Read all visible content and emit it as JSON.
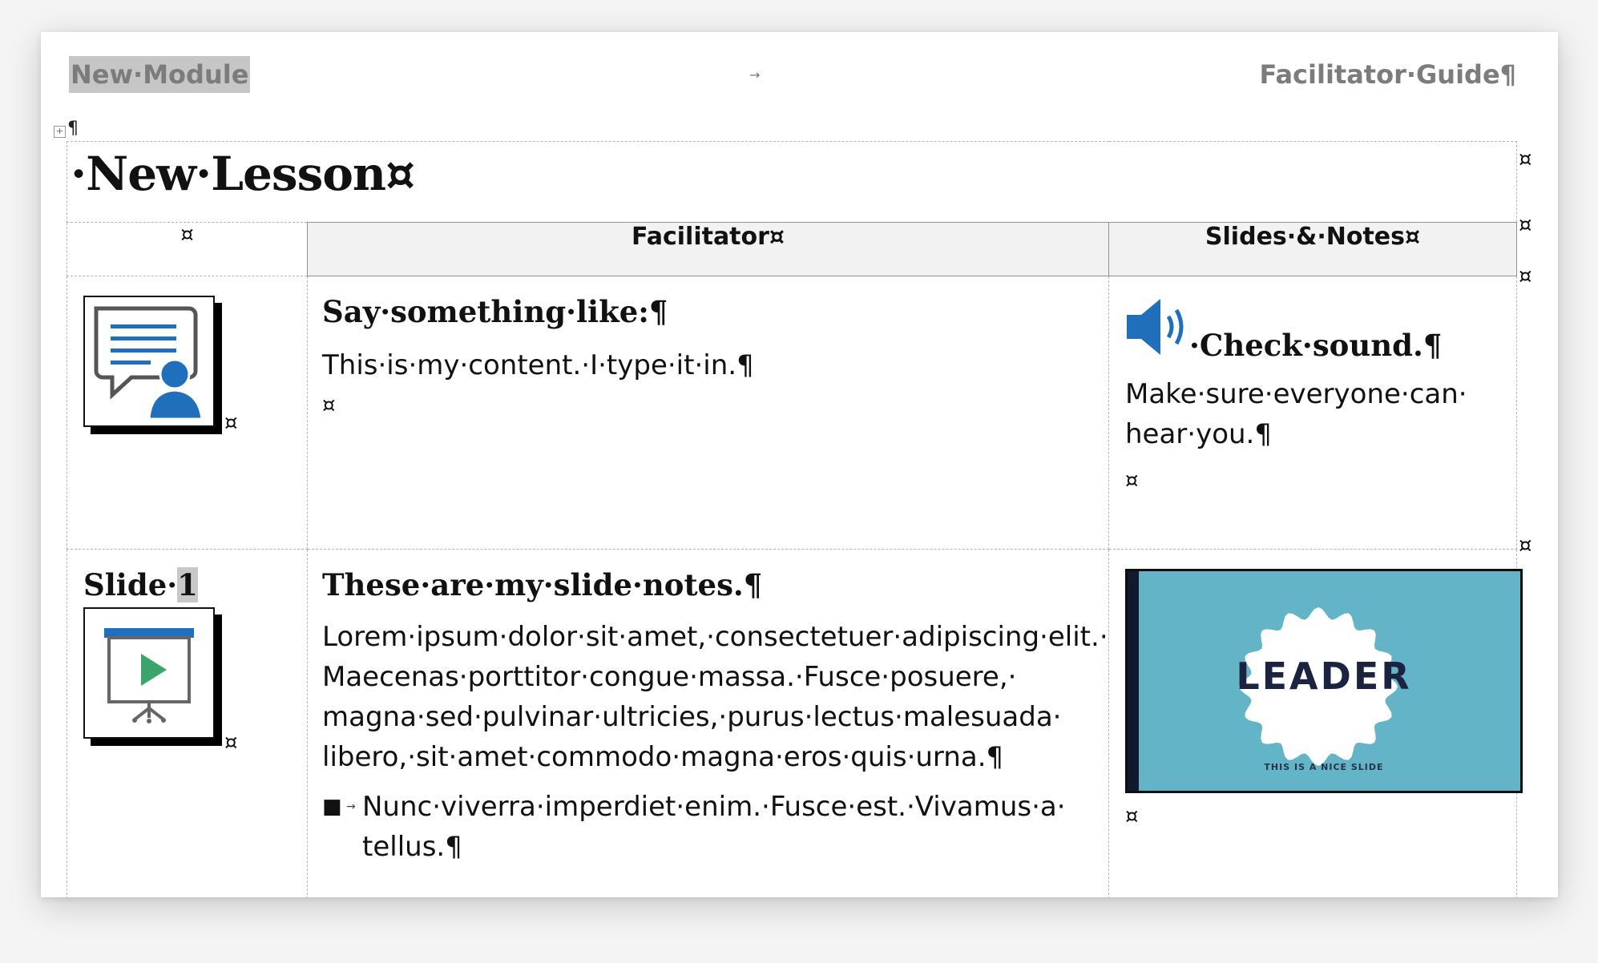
{
  "header": {
    "module": "New·Module",
    "arrow": "→",
    "guide": "Facilitator·Guide¶"
  },
  "marks": {
    "pilcrow": "¶",
    "cell_end": "¤"
  },
  "lesson": {
    "title": "·New·Lesson¤"
  },
  "columns": {
    "blank": "¤",
    "facilitator": "Facilitator¤",
    "slides": "Slides·&·Notes¤"
  },
  "row1": {
    "facilitator_heading": "Say·something·like:¶",
    "facilitator_body": "This·is·my·content.·I·type·it·in.¶",
    "notes_heading": "·Check·sound.¶",
    "notes_body_line1": "Make·sure·everyone·can·",
    "notes_body_line2": "hear·you.¶",
    "icons": {
      "left": "presenter-chat-icon",
      "right": "speaker-volume-icon"
    }
  },
  "row2": {
    "slide_label": "Slide·",
    "slide_number": "1",
    "facilitator_heading": "These·are·my·slide·notes.¶",
    "lorem_lines": [
      "Lorem·ipsum·dolor·sit·amet,·consectetuer·adipiscing·elit.·",
      "Maecenas·porttitor·congue·massa.·Fusce·posuere,·",
      "magna·sed·pulvinar·ultricies,·purus·lectus·malesuada·",
      "libero,·sit·amet·commodo·magna·eros·quis·urna.¶"
    ],
    "bullet_glyph": "■",
    "bullet_tab": "→",
    "bullet_lines": [
      "Nunc·viverra·imperdiet·enim.·Fusce·est.·Vivamus·a·",
      "tellus.¶"
    ],
    "slide_image": {
      "word": "LEADER",
      "subtitle": "THIS IS A NICE SLIDE",
      "background": "#62b4c6"
    },
    "icons": {
      "left": "projector-screen-play-icon"
    }
  },
  "colors": {
    "icon_blue": "#1f6fbd",
    "play_green": "#3aa56a",
    "header_gray": "#7c7c7c"
  }
}
